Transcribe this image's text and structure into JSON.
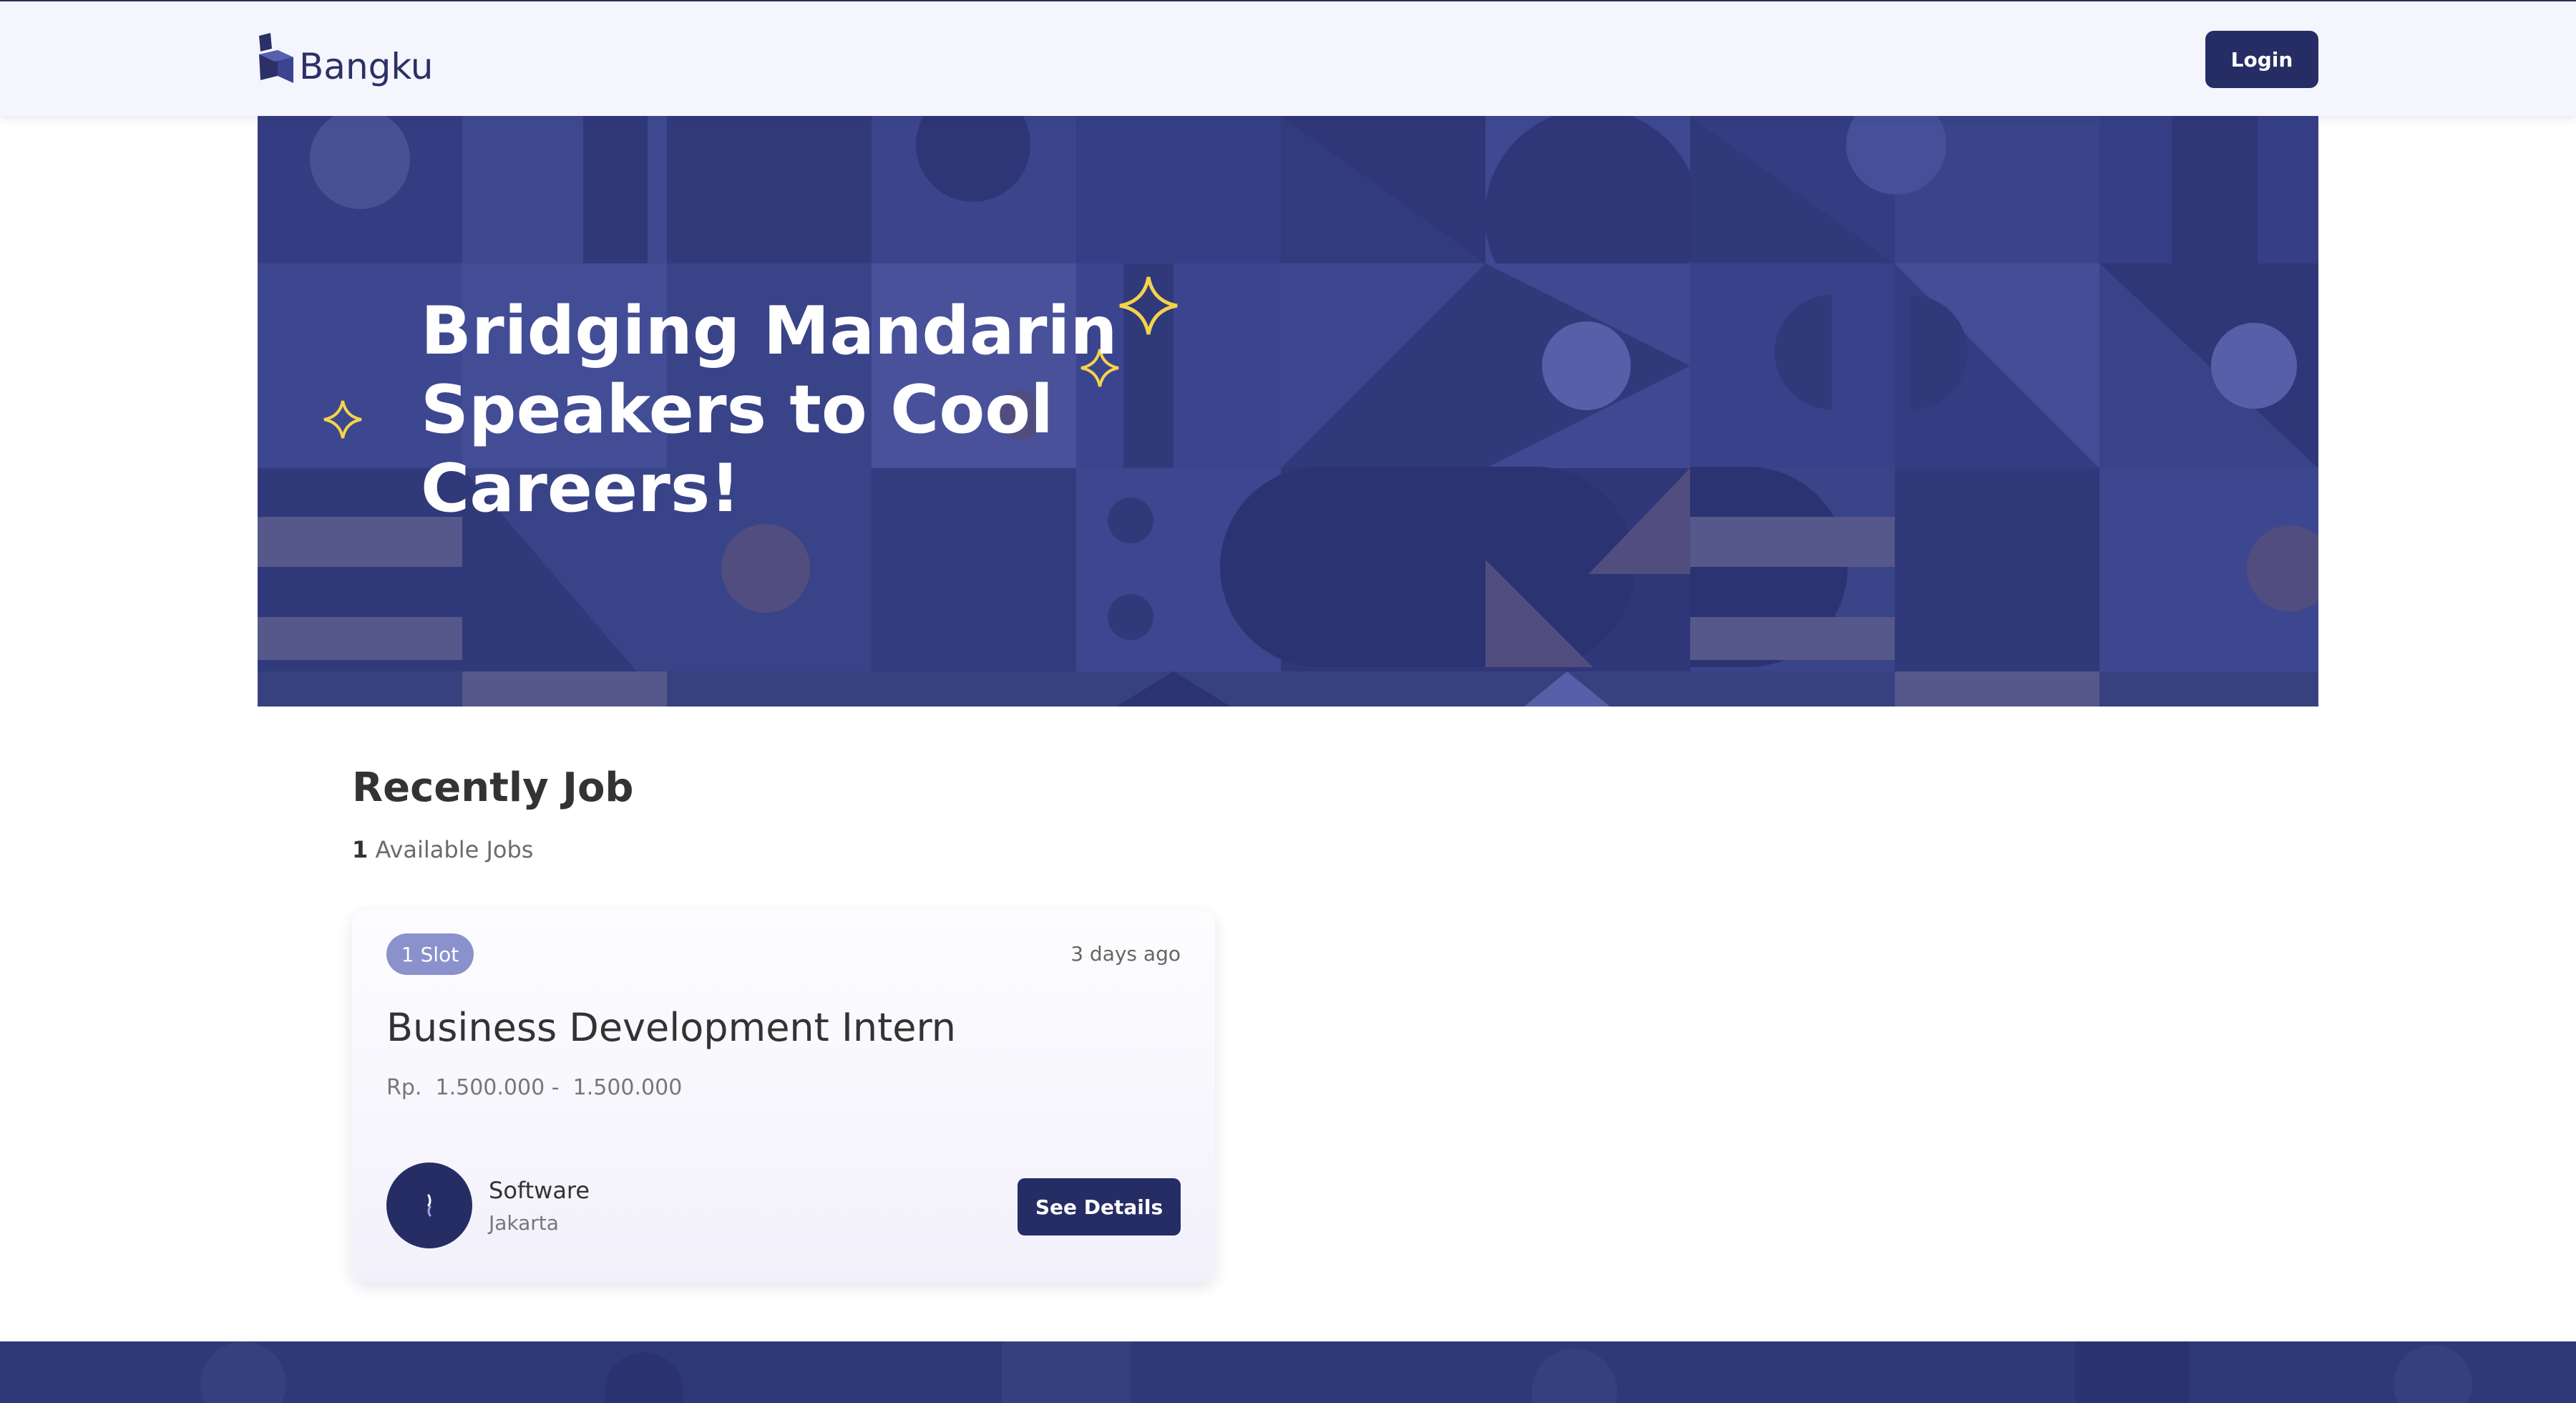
{
  "brand": {
    "name": "Bangku"
  },
  "nav": {
    "login_label": "Login"
  },
  "hero": {
    "title": "Bridging Mandarin\nSpeakers to Cool\nCareers!"
  },
  "jobs": {
    "section_title": "Recently Job",
    "count": "1",
    "count_label": "Available Jobs",
    "items": [
      {
        "slots": "1 Slot",
        "posted": "3 days ago",
        "title": "Business Development Intern",
        "salary": "Rp.  1.500.000 -  1.500.000",
        "company": "Software",
        "location": "Jakarta",
        "details_label": "See Details"
      }
    ]
  },
  "colors": {
    "primary": "#262d65",
    "hero_bg": "#3a4488",
    "badge": "#8b91cc",
    "sparkle": "#f5d34a"
  },
  "icons": [
    "bangku-logo-icon",
    "sparkle-icon",
    "company-logo-icon"
  ]
}
